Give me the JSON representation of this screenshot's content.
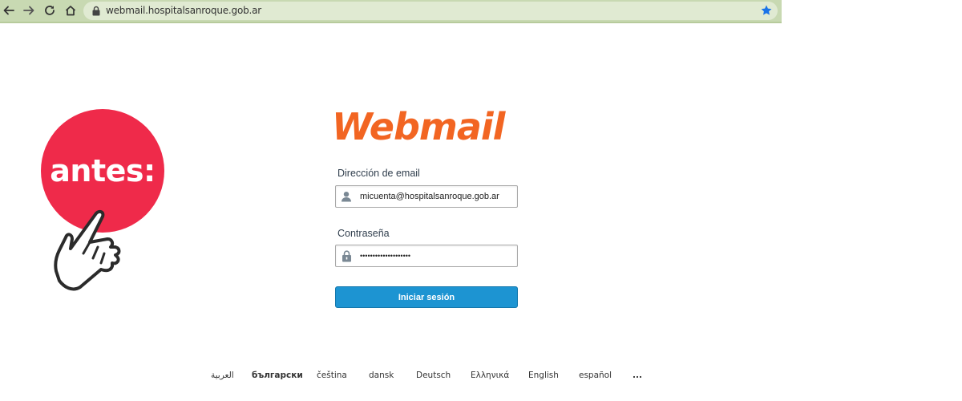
{
  "browser": {
    "url": "webmail.hospitalsanroque.gob.ar",
    "icons": [
      "back-arrow-icon",
      "forward-arrow-icon",
      "reload-icon",
      "home-icon",
      "lock-icon",
      "star-icon"
    ]
  },
  "badge": {
    "text": "antes:",
    "color": "#ef2a4a"
  },
  "logo": {
    "text": "Webmail",
    "color": "#f26522"
  },
  "form": {
    "email_label": "Dirección de email",
    "email_value": "micuenta@hospitalsanroque.gob.ar",
    "password_label": "Contraseña",
    "password_value": "••••••••••••••••••••",
    "submit_label": "Iniciar sesión",
    "button_color": "#1d94d2"
  },
  "languages": [
    "العربية",
    "български",
    "čeština",
    "dansk",
    "Deutsch",
    "Ελληνικά",
    "English",
    "español",
    "..."
  ]
}
